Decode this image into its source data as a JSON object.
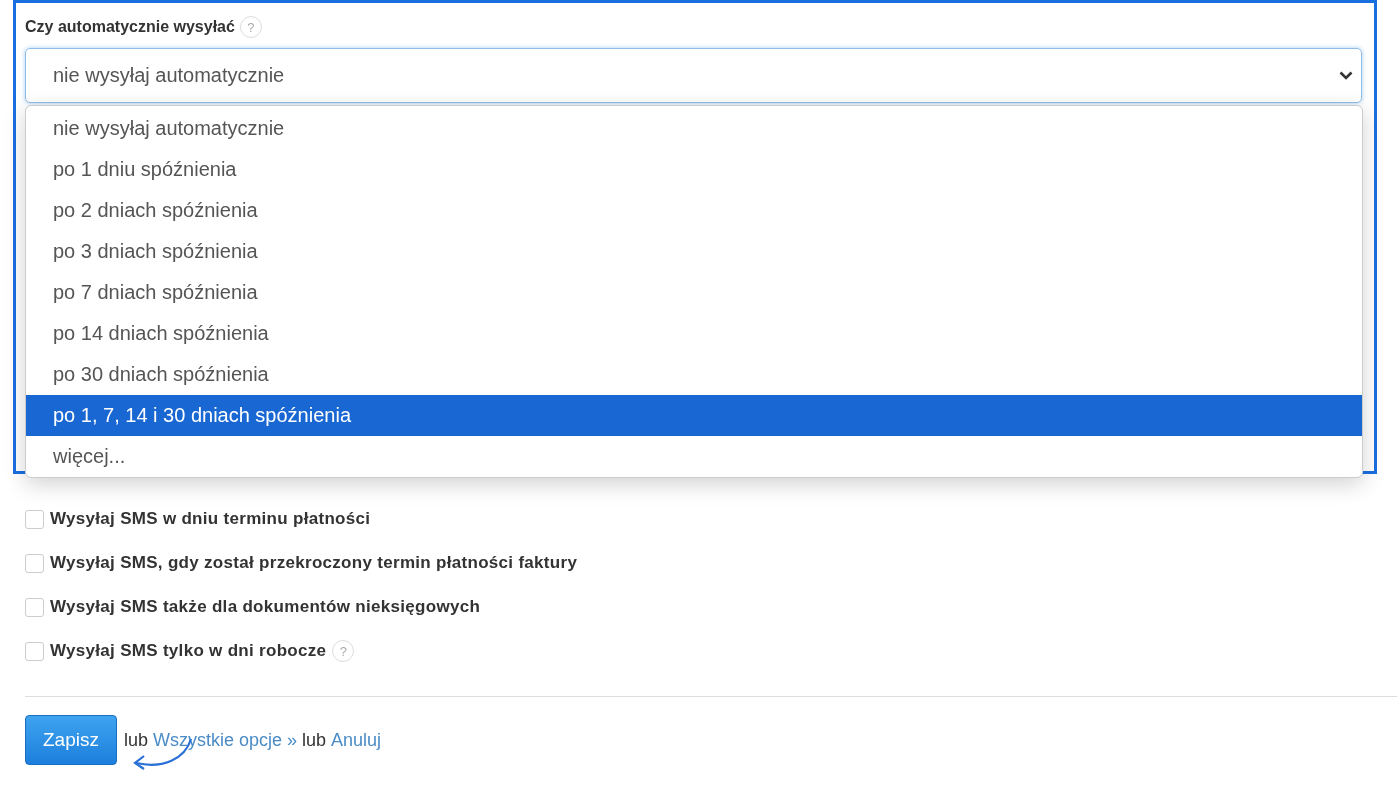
{
  "field": {
    "label": "Czy automatycznie wysyłać",
    "help": "?",
    "value": "nie wysyłaj automatycznie"
  },
  "dropdown": {
    "options": [
      {
        "label": "nie wysyłaj automatycznie",
        "selected": false
      },
      {
        "label": "po 1 dniu spóźnienia",
        "selected": false
      },
      {
        "label": "po 2 dniach spóźnienia",
        "selected": false
      },
      {
        "label": "po 3 dniach spóźnienia",
        "selected": false
      },
      {
        "label": "po 7 dniach spóźnienia",
        "selected": false
      },
      {
        "label": "po 14 dniach spóźnienia",
        "selected": false
      },
      {
        "label": "po 30 dniach spóźnienia",
        "selected": false
      },
      {
        "label": "po 1, 7, 14 i 30 dniach spóźnienia",
        "selected": true
      },
      {
        "label": "więcej...",
        "selected": false
      }
    ]
  },
  "checkboxes": [
    {
      "label": "Wysyłaj SMS w dniu terminu płatności",
      "checked": false
    },
    {
      "label": "Wysyłaj SMS, gdy został przekroczony termin płatności faktury",
      "checked": false
    },
    {
      "label": "Wysyłaj SMS także dla dokumentów nieksięgowych",
      "checked": false
    },
    {
      "label": "Wysyłaj SMS tylko w dni robocze",
      "checked": false,
      "help": "?"
    }
  ],
  "actions": [
    {
      "kind": "button",
      "label": "Zapisz"
    },
    {
      "kind": "text",
      "label": "lub"
    },
    {
      "kind": "link",
      "label": "Wszystkie opcje »"
    },
    {
      "kind": "text",
      "label": "lub"
    },
    {
      "kind": "link",
      "label": "Anuluj"
    }
  ]
}
